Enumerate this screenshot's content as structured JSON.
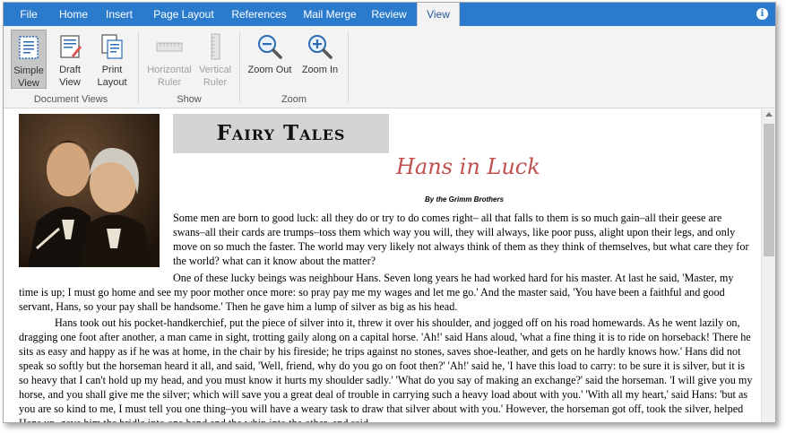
{
  "tabs": [
    "File",
    "Home",
    "Insert",
    "Page Layout",
    "References",
    "Mail Merge",
    "Review",
    "View"
  ],
  "active_tab": "View",
  "ribbon": {
    "document_views": {
      "label": "Document Views",
      "simple_view": "Simple View",
      "draft_view": "Draft View",
      "print_layout": "Print Layout"
    },
    "show": {
      "label": "Show",
      "horizontal_ruler": "Horizontal Ruler",
      "vertical_ruler": "Vertical Ruler"
    },
    "zoom": {
      "label": "Zoom",
      "zoom_out": "Zoom Out",
      "zoom_in": "Zoom In"
    }
  },
  "document": {
    "title": "Fairy Tales",
    "subtitle": "Hans in Luck",
    "byline": "By the Grimm Brothers",
    "paragraphs": [
      "Some men are born to good luck: all they do or try to do comes right– all that falls to them is so much gain–all their geese are swans–all their cards are trumps–toss them which way you will, they will always, like poor puss, alight upon their legs, and only move on so much the faster. The world may very likely not always think of them as they think of themselves, but what care they for the world? what can it know about the matter?",
      "One of these lucky beings was neighbour Hans. Seven long years he had worked hard for his master. At last he said, 'Master, my time is up; I must go home and see my poor mother once more: so pray pay me my wages and let me go.' And the master said, 'You have been a faithful and good servant, Hans, so your pay shall be handsome.' Then he gave him a lump of silver as big as his head.",
      "Hans took out his pocket-handkerchief, put the piece of silver into it, threw it over his shoulder, and jogged off on his road homewards. As he went lazily on, dragging one foot after another, a man came in sight, trotting gaily along on a capital horse. 'Ah!' said Hans aloud, 'what a fine thing it is to ride on horseback! There he sits as easy and happy as if he was at home, in the chair by his fireside; he trips against no stones, saves shoe-leather, and gets on he hardly knows how.' Hans did not speak so softly but the horseman heard it all, and said, 'Well, friend, why do you go on foot then?' 'Ah!' said he, 'I have this load to carry: to be sure it is silver, but it is so heavy that I can't hold up my head, and you must know it hurts my shoulder sadly.' 'What do you say of making an exchange?' said the horseman. 'I will give you my horse, and you shall give me the silver; which will save you a great deal of trouble in carrying such a heavy load about with you.' 'With all my heart,' said Hans: 'but as you are so kind to me, I must tell you one thing–you will have a weary task to draw that silver about with you.' However, the horseman got off, took the silver, helped Hans up, gave him the bridle into one hand and the whip into the other, and said,"
    ]
  }
}
